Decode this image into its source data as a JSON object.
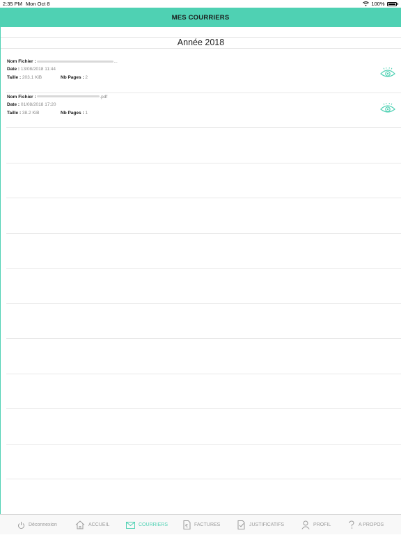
{
  "status_bar": {
    "time": "2:35 PM",
    "date": "Mon Oct 8",
    "battery": "100%"
  },
  "nav": {
    "title": "MES COURRIERS"
  },
  "section": {
    "year_label": "Année 2018"
  },
  "labels": {
    "file_name": "Nom Fichier :",
    "date": "Date :",
    "size": "Taille :",
    "pages": "Nb Pages :"
  },
  "files": [
    {
      "name_suffix": "...",
      "date": "13/08/2018 11:44",
      "size": "203.1 KiB",
      "pages": "2"
    },
    {
      "name_suffix": ".pdf",
      "date": "01/08/2018 17:20",
      "size": "38.2 KiB",
      "pages": "1"
    }
  ],
  "tabs": [
    {
      "label": "Déconnexion",
      "icon": "power-icon",
      "active": false
    },
    {
      "label": "ACCUEIL",
      "icon": "home-icon",
      "active": false
    },
    {
      "label": "COURRIERS",
      "icon": "envelope-icon",
      "active": true
    },
    {
      "label": "FACTURES",
      "icon": "euro-document-icon",
      "active": false
    },
    {
      "label": "JUSTIFICATIFS",
      "icon": "check-document-icon",
      "active": false
    },
    {
      "label": "PROFIL",
      "icon": "user-icon",
      "active": false
    },
    {
      "label": "A PROPOS",
      "icon": "question-icon",
      "active": false
    }
  ],
  "colors": {
    "accent": "#4fd1b3",
    "inactive": "#9a9a9a"
  }
}
